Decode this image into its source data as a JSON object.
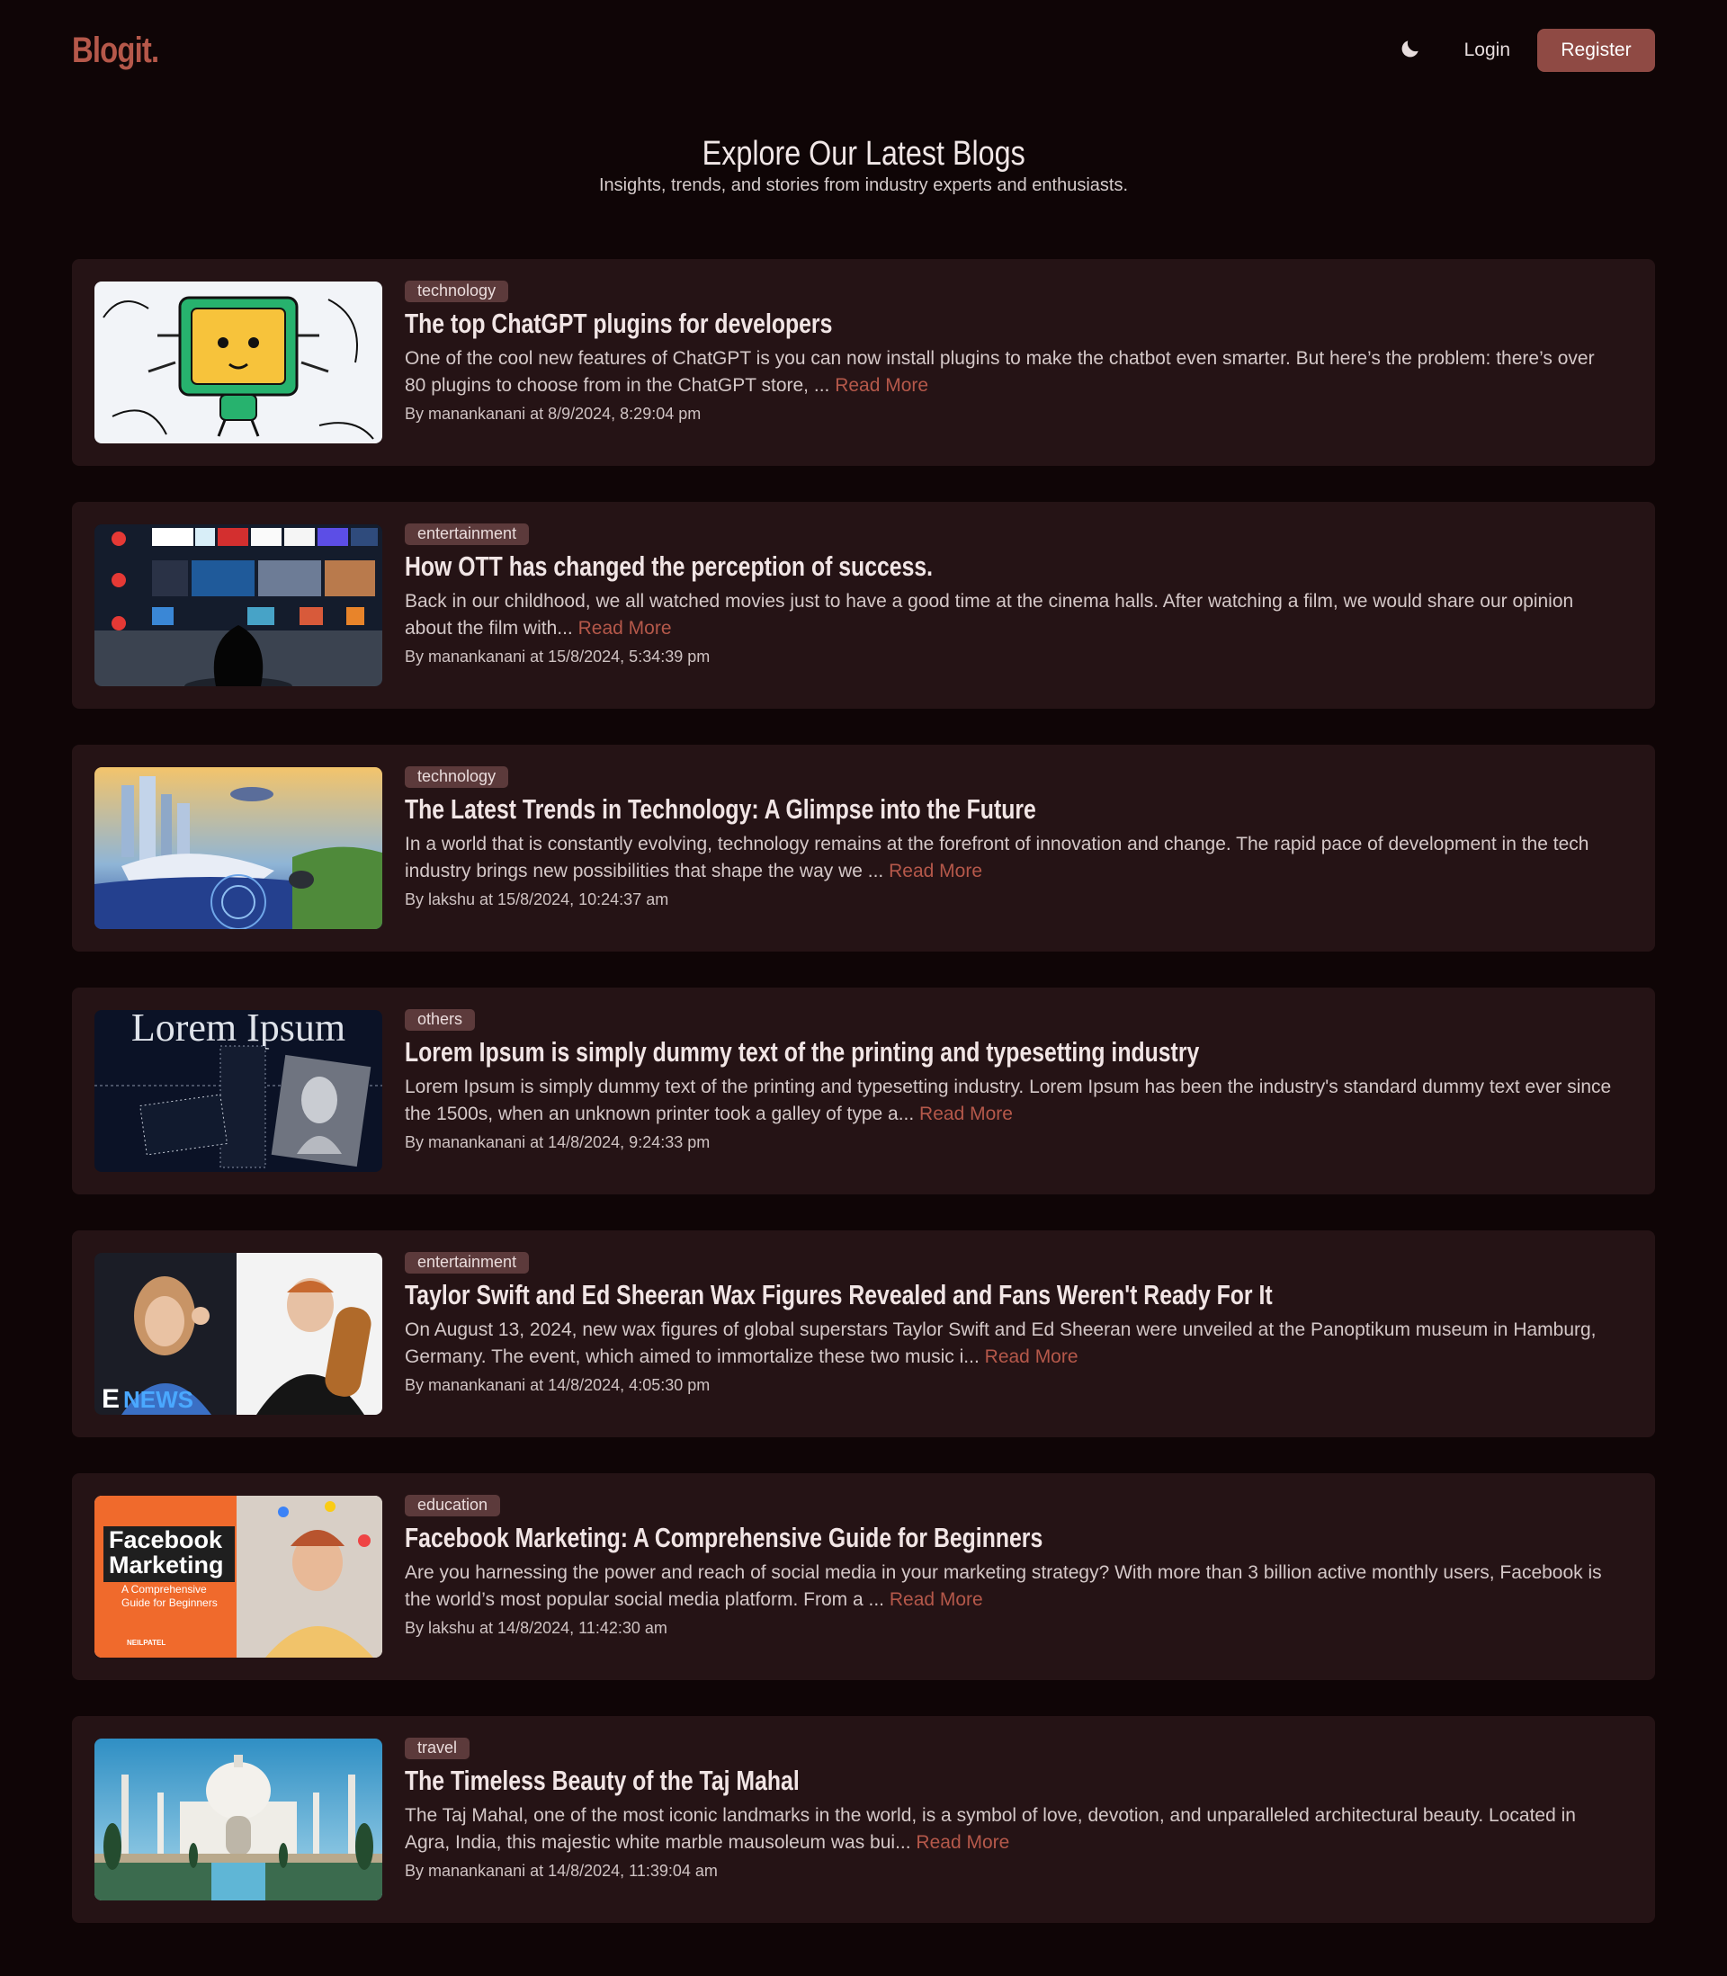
{
  "nav": {
    "logo": "Blogit.",
    "login": "Login",
    "register": "Register",
    "theme_icon": "moon-icon"
  },
  "hero": {
    "title": "Explore Our Latest Blogs",
    "subtitle": "Insights, trends, and stories from industry experts and enthusiasts."
  },
  "read_more_label": "Read More",
  "colors": {
    "accent": "#b5584a",
    "button": "#8f4a44",
    "card": "#251315",
    "background": "#0f0506",
    "badge": "#5c3a3b"
  },
  "posts": [
    {
      "category": "technology",
      "title": "The top ChatGPT plugins for developers",
      "excerpt": "One of the cool new features of ChatGPT is you can now install plugins to make the chatbot even smarter. But here’s the problem: there’s over 80 plugins to choose from in the ChatGPT store, ...",
      "meta": "By manankanani at 8/9/2024, 8:29:04 pm",
      "image": "robot-illustration"
    },
    {
      "category": "entertainment",
      "title": "How OTT has changed the perception of success.",
      "excerpt": "Back in our childhood, we all watched movies just to have a good time at the cinema halls. After watching a film, we would share our opinion about the film with...",
      "meta": "By manankanani at 15/8/2024, 5:34:39 pm",
      "image": "tv-streaming-apps"
    },
    {
      "category": "technology",
      "title": "The Latest Trends in Technology: A Glimpse into the Future",
      "excerpt": "In a world that is constantly evolving, technology remains at the forefront of innovation and change. The rapid pace of development in the tech industry brings new possibilities that shape the way we ...",
      "meta": "By lakshu at 15/8/2024, 10:24:37 am",
      "image": "futuristic-city"
    },
    {
      "category": "others",
      "title": "Lorem Ipsum is simply dummy text of the printing and typesetting industry",
      "excerpt": "Lorem Ipsum is simply dummy text of the printing and typesetting industry. Lorem Ipsum has been the industry's standard dummy text ever since the 1500s, when an unknown printer took a galley of type a...",
      "meta": "By manankanani at 14/8/2024, 9:24:33 pm",
      "image": "lorem-ipsum-collage",
      "image_text": "Lorem Ipsum"
    },
    {
      "category": "entertainment",
      "title": "Taylor Swift and Ed Sheeran Wax Figures Revealed and Fans Weren't Ready For It",
      "excerpt": "On August 13, 2024, new wax figures of global superstars Taylor Swift and Ed Sheeran were unveiled at the Panoptikum museum in Hamburg, Germany. The event, which aimed to immortalize these two music i...",
      "meta": "By manankanani at 14/8/2024, 4:05:30 pm",
      "image": "celebrity-photos",
      "image_text": "NEWS"
    },
    {
      "category": "education",
      "title": "Facebook Marketing: A Comprehensive Guide for Beginners",
      "excerpt": "Are you harnessing the power and reach of social media in your marketing strategy? With more than 3 billion active monthly users, Facebook is the world’s most popular social media platform. From a ...",
      "meta": "By lakshu at 14/8/2024, 11:42:30 am",
      "image": "facebook-marketing-cover",
      "image_text": {
        "line1": "Facebook",
        "line2": "Marketing",
        "sub1": "A Comprehensive",
        "sub2": "Guide for Beginners",
        "brand": "NEILPATEL"
      }
    },
    {
      "category": "travel",
      "title": "The Timeless Beauty of the Taj Mahal",
      "excerpt": "The Taj Mahal, one of the most iconic landmarks in the world, is a symbol of love, devotion, and unparalleled architectural beauty. Located in Agra, India, this majestic white marble mausoleum was bui...",
      "meta": "By manankanani at 14/8/2024, 11:39:04 am",
      "image": "taj-mahal-photo"
    }
  ]
}
